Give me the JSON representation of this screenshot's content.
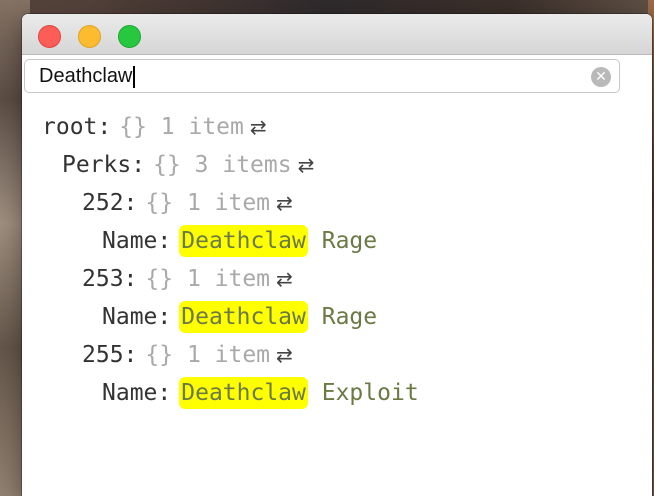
{
  "window": {
    "buttons": [
      "close",
      "minimize",
      "zoom"
    ]
  },
  "search": {
    "value": "Deathclaw",
    "clear_icon": "✕"
  },
  "tree": {
    "swap_icon": "⇄",
    "root": {
      "key": "root",
      "meta": "{} 1 item"
    },
    "perks": {
      "key": "Perks",
      "meta": "{} 3 items"
    },
    "entries": [
      {
        "key": "252",
        "meta": "{} 1 item",
        "name_key": "Name",
        "match": "Deathclaw",
        "rest": "Rage"
      },
      {
        "key": "253",
        "meta": "{} 1 item",
        "name_key": "Name",
        "match": "Deathclaw",
        "rest": "Rage"
      },
      {
        "key": "255",
        "meta": "{} 1 item",
        "name_key": "Name",
        "match": "Deathclaw",
        "rest": "Exploit"
      }
    ]
  },
  "colors": {
    "highlight": "#ffff00",
    "value_text": "#6b7a45",
    "meta_text": "#a9a9a9"
  }
}
